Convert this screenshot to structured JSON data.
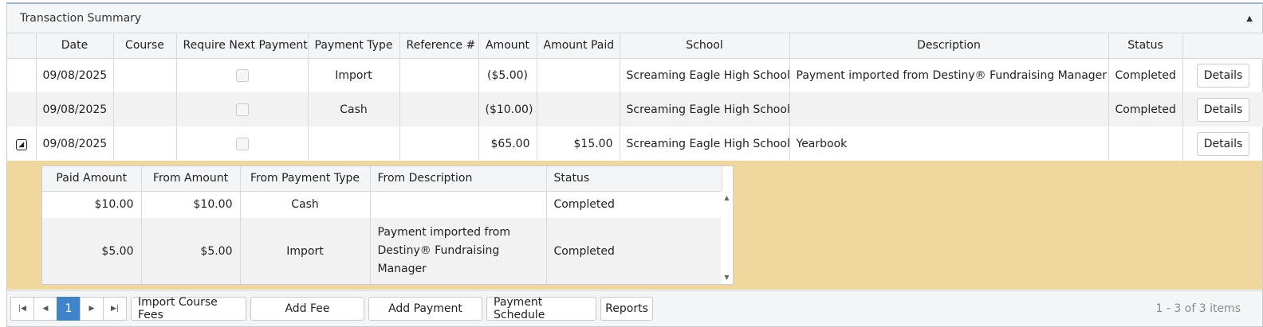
{
  "panel": {
    "title": "Transaction Summary"
  },
  "grid": {
    "headers": [
      "Date",
      "Course",
      "Require Next Payment",
      "Payment Type",
      "Reference #",
      "Amount",
      "Amount Paid",
      "School",
      "Description",
      "Status"
    ],
    "rows": [
      {
        "date": "09/08/2025",
        "course": "",
        "payment_type": "Import",
        "reference": "",
        "amount": "($5.00)",
        "amount_paid": "",
        "school": "Screaming Eagle High School",
        "description": "Payment imported from Destiny® Fundraising Manager",
        "status": "Completed",
        "action": "Details"
      },
      {
        "date": "09/08/2025",
        "course": "",
        "payment_type": "Cash",
        "reference": "",
        "amount": "($10.00)",
        "amount_paid": "",
        "school": "Screaming Eagle High School",
        "description": "",
        "status": "Completed",
        "action": "Details"
      },
      {
        "date": "09/08/2025",
        "course": "",
        "payment_type": "",
        "reference": "",
        "amount": "$65.00",
        "amount_paid": "$15.00",
        "school": "Screaming Eagle High School",
        "description": "Yearbook",
        "status": "",
        "action": "Details"
      }
    ]
  },
  "detail": {
    "headers": [
      "Paid Amount",
      "From Amount",
      "From Payment Type",
      "From Description",
      "Status"
    ],
    "rows": [
      {
        "paid_amount": "$10.00",
        "from_amount": "$10.00",
        "from_payment_type": "Cash",
        "from_description": "",
        "status": "Completed"
      },
      {
        "paid_amount": "$5.00",
        "from_amount": "$5.00",
        "from_payment_type": "Import",
        "from_description": "Payment imported from Destiny® Fundraising Manager",
        "status": "Completed"
      }
    ]
  },
  "pager": {
    "current_page": "1",
    "buttons": [
      "Import Course Fees",
      "Add Fee",
      "Add Payment",
      "Payment Schedule",
      "Reports"
    ],
    "items_info": "1 - 3 of 3 items"
  },
  "icons": {
    "collapse": "triangle-up-icon",
    "first": "first-page-icon",
    "prev": "prev-page-icon",
    "next": "next-page-icon",
    "last": "last-page-icon",
    "expand": "collapse-row-icon"
  },
  "colors": {
    "accent": "#3f84c8",
    "detail_background": "#f0d79d",
    "header_background": "#f4f5f7"
  }
}
